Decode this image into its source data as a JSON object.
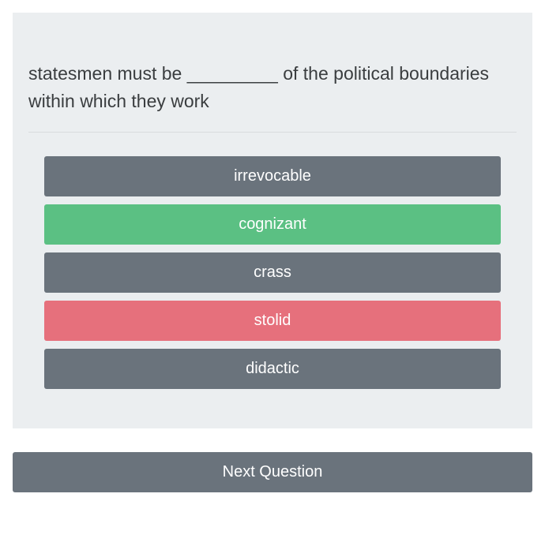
{
  "question": {
    "text": "statesmen must be _________ of the political boundaries within which they work"
  },
  "answers": [
    {
      "label": "irrevocable",
      "state": "default"
    },
    {
      "label": "cognizant",
      "state": "correct"
    },
    {
      "label": "crass",
      "state": "default"
    },
    {
      "label": "stolid",
      "state": "incorrect"
    },
    {
      "label": "didactic",
      "state": "default"
    }
  ],
  "next_button_label": "Next Question"
}
